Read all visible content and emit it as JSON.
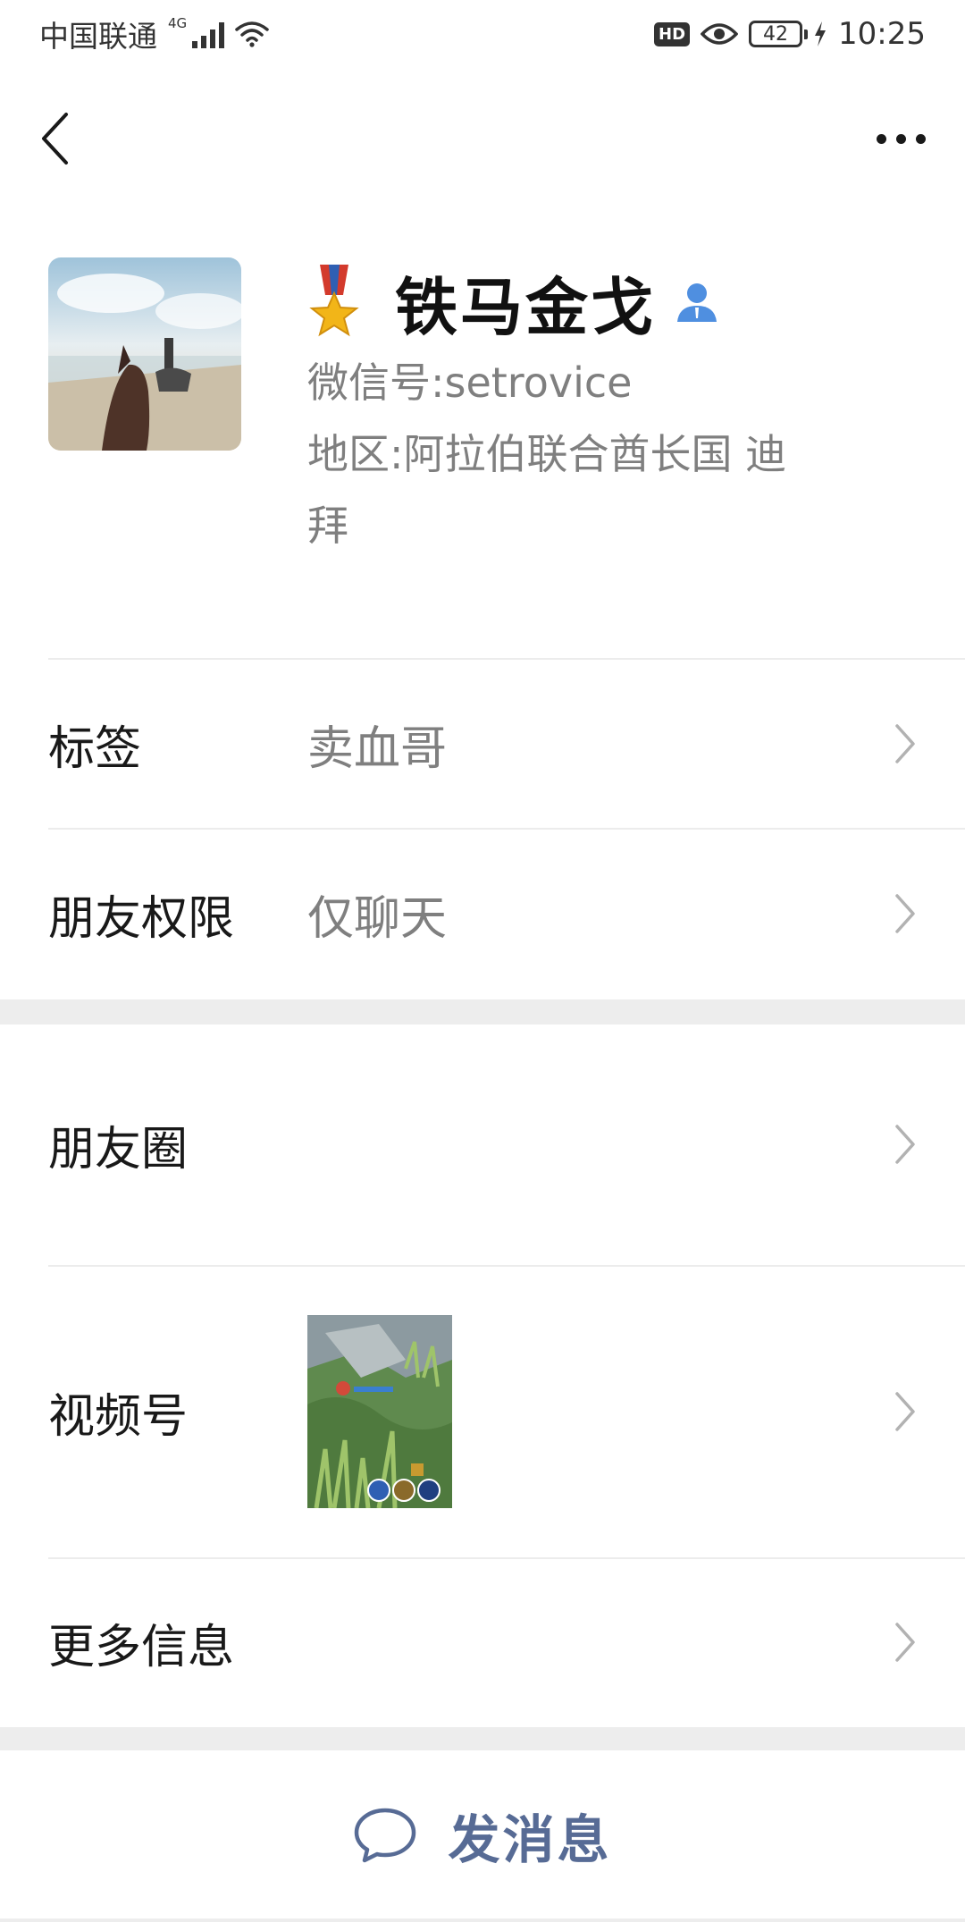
{
  "status_bar": {
    "carrier": "中国联通",
    "network": "4G",
    "hd": "HD",
    "battery": "42",
    "time": "10:25"
  },
  "profile": {
    "name": "铁马金戈",
    "wechat_id_label": "微信号:",
    "wechat_id": "setrovice",
    "region_label": "地区:",
    "region_line1": "阿拉伯联合酋长国  迪",
    "region_line2": "拜"
  },
  "rows": {
    "tags": {
      "label": "标签",
      "value": "卖血哥"
    },
    "permissions": {
      "label": "朋友权限",
      "value": "仅聊天"
    },
    "moments": {
      "label": "朋友圈"
    },
    "channels": {
      "label": "视频号"
    },
    "more_info": {
      "label": "更多信息"
    }
  },
  "actions": {
    "send_message": "发消息"
  },
  "colors": {
    "link_blue": "#576b95",
    "gray_text": "#7f7f7f",
    "section_bg": "#ededed"
  },
  "icons": [
    "back-icon",
    "more-icon",
    "medal-icon",
    "contact-icon",
    "chevron-right-icon",
    "chat-bubble-icon"
  ]
}
